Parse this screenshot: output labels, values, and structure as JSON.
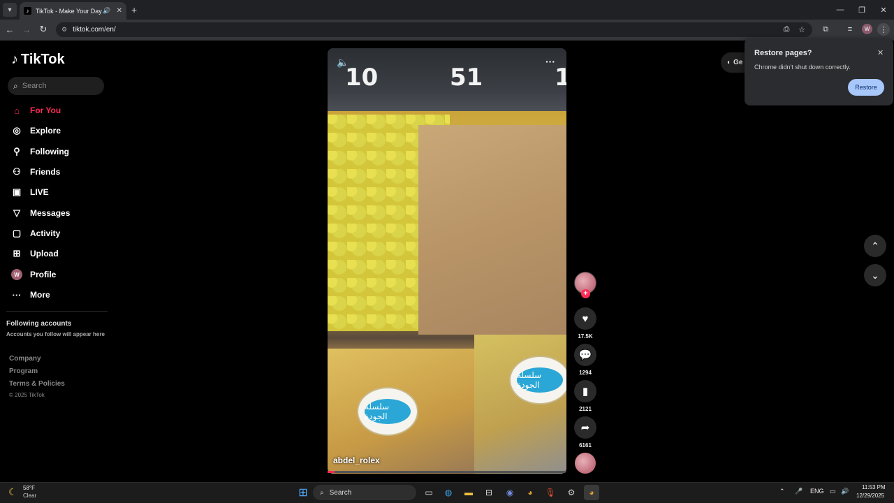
{
  "browser": {
    "tab_title": "TikTok - Make Your Day",
    "url": "tiktok.com/en/",
    "profile_initial": "W"
  },
  "sidebar": {
    "logo": "TikTok",
    "search_placeholder": "Search",
    "items": [
      {
        "label": "For You",
        "icon": "home-icon"
      },
      {
        "label": "Explore",
        "icon": "compass-icon"
      },
      {
        "label": "Following",
        "icon": "person-follow-icon"
      },
      {
        "label": "Friends",
        "icon": "friends-icon"
      },
      {
        "label": "LIVE",
        "icon": "live-icon"
      },
      {
        "label": "Messages",
        "icon": "send-icon"
      },
      {
        "label": "Activity",
        "icon": "activity-icon"
      },
      {
        "label": "Upload",
        "icon": "upload-icon"
      },
      {
        "label": "Profile",
        "icon": "profile-avatar"
      },
      {
        "label": "More",
        "icon": "more-icon"
      }
    ],
    "profile_initial": "W",
    "following_heading": "Following accounts",
    "following_placeholder": "Accounts you follow will appear here",
    "footer_links": [
      "Company",
      "Program",
      "Terms & Policies"
    ],
    "copyright": "© 2025 TikTok"
  },
  "video": {
    "author": "abdel_rolex",
    "prices": [
      "10",
      "51",
      "1"
    ],
    "label_text": "سلسلة الجودة",
    "progress": 0.03
  },
  "actions": {
    "likes": "17.5K",
    "comments": "1294",
    "bookmarks": "2121",
    "shares": "6161"
  },
  "get_app_label": "Ge",
  "restore_popup": {
    "title": "Restore pages?",
    "message": "Chrome didn't shut down correctly.",
    "button": "Restore"
  },
  "taskbar": {
    "temperature": "58°F",
    "condition": "Clear",
    "search_placeholder": "Search",
    "language": "ENG",
    "time": "11:53 PM",
    "date": "12/29/2025"
  },
  "colors": {
    "accent": "#fe2c55",
    "restore_button": "#a8c7fa"
  }
}
